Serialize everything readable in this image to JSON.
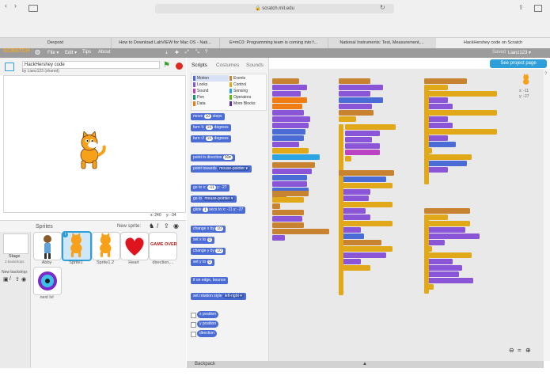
{
  "browser": {
    "url": "scratch.mit.edu",
    "tabs": [
      {
        "label": "Devpost"
      },
      {
        "label": "How to Download LabVIEW for Mac OS - Nati..."
      },
      {
        "label": "E=mC0: Programming team is coming into f..."
      },
      {
        "label": "National Instruments: Test, Measurement,..."
      },
      {
        "label": "HackHershey code on Scratch",
        "active": true
      }
    ]
  },
  "menubar": {
    "logo": "SCRATCH",
    "items": [
      "File ▾",
      "Edit ▾",
      "Tips",
      "About"
    ],
    "saved": "Saved",
    "user": "Lianz123 ▾",
    "see_project": "See project page"
  },
  "project": {
    "title": "HackHershey code",
    "by": "by Lianz123 (shared)"
  },
  "stage": {
    "x_label": "x: 240",
    "y_label": "y: -34",
    "sprite_x": "x: -11",
    "sprite_y": "y: -27"
  },
  "editor_tabs": [
    "Scripts",
    "Costumes",
    "Sounds"
  ],
  "categories": [
    {
      "name": "Motion",
      "color": "#4a6cd4",
      "active": true
    },
    {
      "name": "Looks",
      "color": "#8a55d7"
    },
    {
      "name": "Sound",
      "color": "#bb42c3"
    },
    {
      "name": "Pen",
      "color": "#0e9a6c"
    },
    {
      "name": "Data",
      "color": "#ee7d16"
    },
    {
      "name": "Events",
      "color": "#c88330"
    },
    {
      "name": "Control",
      "color": "#e1a91a"
    },
    {
      "name": "Sensing",
      "color": "#2ca5e2"
    },
    {
      "name": "Operators",
      "color": "#5cb712"
    },
    {
      "name": "More Blocks",
      "color": "#632d99"
    }
  ],
  "blocks": [
    {
      "text": "move",
      "arg": "10",
      "tail": "steps"
    },
    {
      "text": "turn ↻",
      "arg": "15",
      "tail": "degrees"
    },
    {
      "text": "turn ↺",
      "arg": "15",
      "tail": "degrees"
    },
    {
      "text": "point in direction",
      "arg": "90▾",
      "tail": ""
    },
    {
      "text": "point towards",
      "arg": "mouse-pointer ▾",
      "tail": ""
    },
    {
      "text": "go to x:",
      "arg": "-11",
      "tail": "y: -27"
    },
    {
      "text": "go to",
      "arg": "mouse-pointer ▾",
      "tail": ""
    },
    {
      "text": "glide",
      "arg": "1",
      "tail": "secs to x: -11 y: -27"
    },
    {
      "text": "change x by",
      "arg": "10",
      "tail": ""
    },
    {
      "text": "set x to",
      "arg": "0",
      "tail": ""
    },
    {
      "text": "change y by",
      "arg": "10",
      "tail": ""
    },
    {
      "text": "set y to",
      "arg": "0",
      "tail": ""
    },
    {
      "text": "if on edge, bounce",
      "arg": "",
      "tail": ""
    },
    {
      "text": "set rotation style",
      "arg": "left-right ▾",
      "tail": ""
    }
  ],
  "reporters": [
    "x position",
    "y position",
    "direction"
  ],
  "sprites": {
    "header": "Sprites",
    "new_sprite": "New sprite:",
    "stage_label": "Stage",
    "stage_backdrops": "3 backdrops",
    "new_backdrop": "New backdrop:",
    "items": [
      {
        "name": "Abby"
      },
      {
        "name": "Sprite1",
        "selected": true
      },
      {
        "name": "Sprite1.2"
      },
      {
        "name": "Heart"
      },
      {
        "name": "direction,..."
      },
      {
        "name": "next lvl"
      }
    ],
    "game_over": "GAME OVER"
  },
  "backpack": "Backpack"
}
